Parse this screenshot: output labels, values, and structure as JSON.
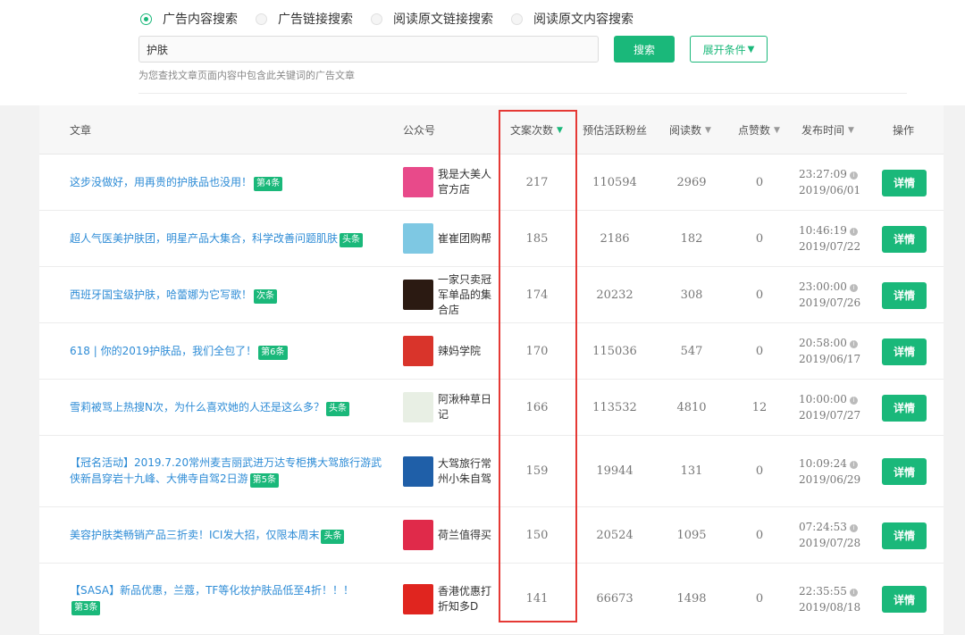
{
  "search_modes": [
    {
      "label": "广告内容搜索",
      "checked": true
    },
    {
      "label": "广告链接搜索",
      "checked": false
    },
    {
      "label": "阅读原文链接搜索",
      "checked": false
    },
    {
      "label": "阅读原文内容搜索",
      "checked": false
    }
  ],
  "search": {
    "value": "护肤",
    "button_label": "搜索",
    "expand_label": "展开条件",
    "hint": "为您查找文章页面内容中包含此关键词的广告文章"
  },
  "table": {
    "headers": {
      "article": "文章",
      "account": "公众号",
      "ad_count": "文案次数",
      "fans": "预估活跃粉丝",
      "reads": "阅读数",
      "likes": "点赞数",
      "publish_time": "发布时间",
      "action": "操作"
    },
    "sort_symbol": "▼",
    "detail_label": "详情",
    "rows": [
      {
        "title": "这步没做好，用再贵的护肤品也没用！",
        "tag": "第4条",
        "account": "我是大美人官方店",
        "ad_count": "217",
        "fans": "110594",
        "reads": "2969",
        "likes": "0",
        "time": "23:27:09",
        "date": "2019/06/01",
        "avatar_color": "#e84a8a"
      },
      {
        "title": "超人气医美护肤团，明星产品大集合，科学改善问题肌肤",
        "tag": "头条",
        "account": "崔崔团购帮",
        "ad_count": "185",
        "fans": "2186",
        "reads": "182",
        "likes": "0",
        "time": "10:46:19",
        "date": "2019/07/22",
        "avatar_color": "#7ec8e3"
      },
      {
        "title": "西班牙国宝级护肤，哈蕾娜为它写歌！",
        "tag": "次条",
        "account": "一家只卖冠军单品的集合店",
        "ad_count": "174",
        "fans": "20232",
        "reads": "308",
        "likes": "0",
        "time": "23:00:00",
        "date": "2019/07/26",
        "avatar_color": "#2b1a12"
      },
      {
        "title": "618 | 你的2019护肤品，我们全包了！",
        "tag": "第6条",
        "account": "辣妈学院",
        "ad_count": "170",
        "fans": "115036",
        "reads": "547",
        "likes": "0",
        "time": "20:58:00",
        "date": "2019/06/17",
        "avatar_color": "#d9342b"
      },
      {
        "title": "雪莉被骂上热搜N次，为什么喜欢她的人还是这么多？",
        "tag": "头条",
        "account": "阿湫种草日记",
        "ad_count": "166",
        "fans": "113532",
        "reads": "4810",
        "likes": "12",
        "time": "10:00:00",
        "date": "2019/07/27",
        "avatar_color": "#e8efe4"
      },
      {
        "title": "【冠名活动】2019.7.20常州麦吉丽武进万达专柜携大驾旅行游武侠新昌穿岩十九峰、大佛寺自驾2日游",
        "tag": "第5条",
        "account": "大驾旅行常州小朱自驾",
        "ad_count": "159",
        "fans": "19944",
        "reads": "131",
        "likes": "0",
        "time": "10:09:24",
        "date": "2019/06/29",
        "avatar_color": "#1f5fa8"
      },
      {
        "title": "美容护肤类畅销产品三折卖！ICI发大招，仅限本周末",
        "tag": "头条",
        "account": "荷兰值得买",
        "ad_count": "150",
        "fans": "20524",
        "reads": "1095",
        "likes": "0",
        "time": "07:24:53",
        "date": "2019/07/28",
        "avatar_color": "#e02a4a"
      },
      {
        "title": "【SASA】新品优惠，兰蔻，TF等化妆护肤品低至4折！！！",
        "tag": "第3条",
        "account": "香港优惠打折知多D",
        "ad_count": "141",
        "fans": "66673",
        "reads": "1498",
        "likes": "0",
        "time": "22:35:55",
        "date": "2019/08/18",
        "avatar_color": "#e0251f"
      }
    ]
  }
}
